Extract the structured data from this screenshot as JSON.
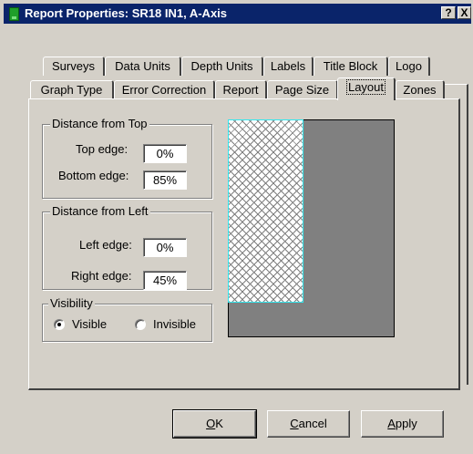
{
  "window": {
    "title": "Report Properties: SR18 IN1, A-Axis",
    "help_button": "?",
    "close_button": "X"
  },
  "tabs": {
    "row1": [
      "Surveys",
      "Data Units",
      "Depth Units",
      "Labels",
      "Title Block",
      "Logo"
    ],
    "row2": [
      "Graph Type",
      "Error Correction",
      "Report",
      "Page Size",
      "Layout",
      "Zones"
    ],
    "active": "Layout"
  },
  "distance_from_top": {
    "title": "Distance from Top",
    "top_edge_label": "Top edge:",
    "top_edge_value": "0%",
    "bottom_edge_label": "Bottom edge:",
    "bottom_edge_value": "85%"
  },
  "distance_from_left": {
    "title": "Distance from Left",
    "left_edge_label": "Left edge:",
    "left_edge_value": "0%",
    "right_edge_label": "Right edge:",
    "right_edge_value": "45%"
  },
  "visibility": {
    "title": "Visibility",
    "visible_label": "Visible",
    "invisible_label": "Invisible",
    "selected": "Visible"
  },
  "buttons": {
    "ok_prefix": "",
    "ok_mnemonic": "O",
    "ok_rest": "K",
    "cancel_mnemonic": "C",
    "cancel_rest": "ancel",
    "apply_mnemonic": "A",
    "apply_rest": "pply"
  },
  "colors": {
    "titlebar": "#0a246a",
    "dialog_face": "#d4d0c8",
    "preview_page": "#808080",
    "preview_region_border": "#33e8ef"
  }
}
